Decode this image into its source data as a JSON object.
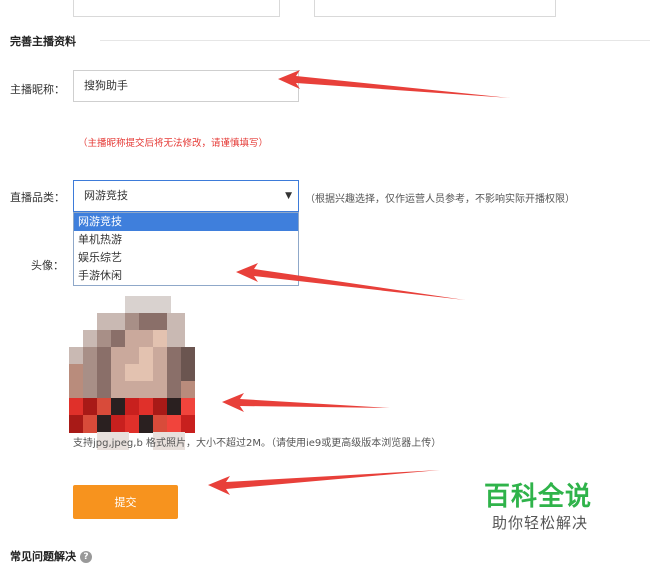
{
  "section": {
    "title": "完善主播资料"
  },
  "nickname": {
    "label": "主播昵称：",
    "value": "搜狗助手",
    "warning": "（主播昵称提交后将无法修改，请谨慎填写）"
  },
  "category": {
    "label": "直播品类：",
    "selected": "网游竞技",
    "hint": "（根据兴趣选择，仅作运营人员参考，不影响实际开播权限）",
    "options": [
      "网游竞技",
      "单机热游",
      "娱乐综艺",
      "手游休闲"
    ]
  },
  "avatar": {
    "label": "头像：",
    "note": "支持jpg,jpeg,b      格式照片，大小不超过2M。（请使用ie9或更高级版本浏览器上传）"
  },
  "submit_label": "提交",
  "faq": {
    "title": "常见问题解决"
  },
  "watermark": {
    "title": "百科全说",
    "subtitle": "助你轻松解决"
  },
  "colors": {
    "accent": "#f7931e",
    "select_highlight": "#3f7fdc",
    "warning": "#e53935",
    "arrow": "#e8403a",
    "watermark": "#2fb34a"
  }
}
